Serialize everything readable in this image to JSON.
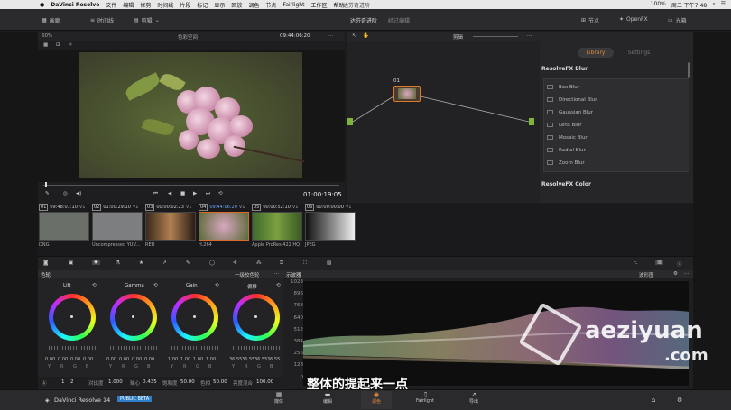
{
  "menubar": {
    "app": "DaVinci Resolve",
    "items": [
      "文件",
      "编辑",
      "修剪",
      "时间线",
      "片段",
      "标记",
      "显示",
      "回放",
      "调色",
      "节点",
      "Fairlight",
      "工作区",
      "帮助"
    ],
    "center_title": "达芬奇进阶",
    "status": "100%",
    "clock": "周二 下午7:48"
  },
  "toolbar": {
    "media": "画廊",
    "timeline": "时间线",
    "clip_menu": "剪辑",
    "project_title": "达芬奇进阶",
    "edited": "经过编辑",
    "nodes": "节点",
    "openfx": "OpenFX",
    "lightbox": "光箱"
  },
  "viewer": {
    "zoom": "60%",
    "colorspace": "色彩空间",
    "timecode_top": "09:44:06:20",
    "timecode_bottom": "01:00:19:05"
  },
  "nodes": {
    "mode": "剪辑",
    "node_label": "01"
  },
  "library": {
    "tabs": [
      "Library",
      "Settings"
    ],
    "section1": "ResolveFX Blur",
    "items": [
      "Box Blur",
      "Directional Blur",
      "Gaussian Blur",
      "Lens Blur",
      "Mosaic Blur",
      "Radial Blur",
      "Zoom Blur"
    ],
    "section2": "ResolveFX Color"
  },
  "clips": [
    {
      "num": "01",
      "tc": "09:48:01:10",
      "track": "V1",
      "name": "DNG"
    },
    {
      "num": "02",
      "tc": "01:00:29:10",
      "track": "V1",
      "name": "Uncompressed YUV..."
    },
    {
      "num": "03",
      "tc": "00:00:02:23",
      "track": "V1",
      "name": "RED"
    },
    {
      "num": "04",
      "tc": "09:44:06:20",
      "track": "V1",
      "name": "H.264"
    },
    {
      "num": "05",
      "tc": "00:00:52:10",
      "track": "V1",
      "name": "Apple ProRes 422 HQ"
    },
    {
      "num": "06",
      "tc": "00:00:00:00",
      "track": "V1",
      "name": "JPEG"
    }
  ],
  "wheels": {
    "panel_title": "色轮",
    "mode": "一级校色轮",
    "labels": [
      "Lift",
      "Gamma",
      "Gain",
      "偏移"
    ],
    "values": [
      [
        "0.00",
        "0.00",
        "0.00",
        "0.00"
      ],
      [
        "0.00",
        "0.00",
        "0.00",
        "0.00"
      ],
      [
        "1.00",
        "1.00",
        "1.00",
        "1.00"
      ],
      [
        "36.55",
        "36.55",
        "36.55",
        "36.55"
      ]
    ],
    "channels": [
      "Y",
      "R",
      "G",
      "B"
    ],
    "footer": {
      "page1": "1",
      "page2": "2",
      "contrast_label": "对比度",
      "contrast": "1.000",
      "pivot_label": "轴心",
      "pivot": "0.435",
      "sat_label": "饱和度",
      "sat": "50.00",
      "hue_label": "色相",
      "hue": "50.00",
      "lum_label": "亮度混合",
      "lum": "100.00"
    }
  },
  "scopes": {
    "title": "示波器",
    "mode": "波形图",
    "scale": [
      "1023",
      "896",
      "768",
      "640",
      "512",
      "384",
      "256",
      "128",
      "0"
    ]
  },
  "subtitle": "整体的提起来一点",
  "watermark": "aeziyuan",
  "watermark_suffix": ".com",
  "bottom": {
    "app": "DaVinci Resolve 14",
    "badge": "PUBLIC BETA",
    "pages": [
      "媒体",
      "编辑",
      "调色",
      "Fairlight",
      "导出"
    ]
  }
}
